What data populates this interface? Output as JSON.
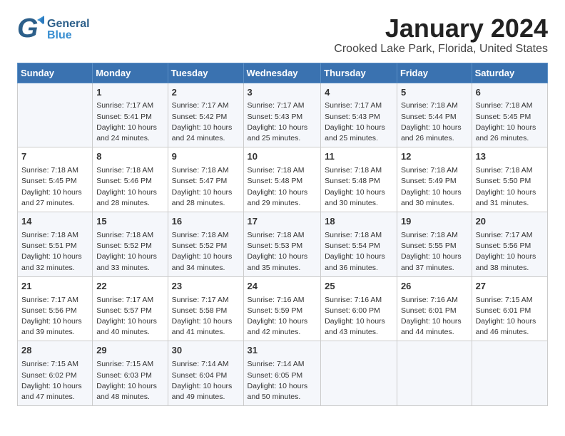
{
  "header": {
    "logo_general": "General",
    "logo_blue": "Blue",
    "title": "January 2024",
    "subtitle": "Crooked Lake Park, Florida, United States"
  },
  "days": [
    "Sunday",
    "Monday",
    "Tuesday",
    "Wednesday",
    "Thursday",
    "Friday",
    "Saturday"
  ],
  "weeks": [
    [
      {
        "date": "",
        "content": ""
      },
      {
        "date": "1",
        "content": "Sunrise: 7:17 AM\nSunset: 5:41 PM\nDaylight: 10 hours\nand 24 minutes."
      },
      {
        "date": "2",
        "content": "Sunrise: 7:17 AM\nSunset: 5:42 PM\nDaylight: 10 hours\nand 24 minutes."
      },
      {
        "date": "3",
        "content": "Sunrise: 7:17 AM\nSunset: 5:43 PM\nDaylight: 10 hours\nand 25 minutes."
      },
      {
        "date": "4",
        "content": "Sunrise: 7:17 AM\nSunset: 5:43 PM\nDaylight: 10 hours\nand 25 minutes."
      },
      {
        "date": "5",
        "content": "Sunrise: 7:18 AM\nSunset: 5:44 PM\nDaylight: 10 hours\nand 26 minutes."
      },
      {
        "date": "6",
        "content": "Sunrise: 7:18 AM\nSunset: 5:45 PM\nDaylight: 10 hours\nand 26 minutes."
      }
    ],
    [
      {
        "date": "7",
        "content": "Sunrise: 7:18 AM\nSunset: 5:45 PM\nDaylight: 10 hours\nand 27 minutes."
      },
      {
        "date": "8",
        "content": "Sunrise: 7:18 AM\nSunset: 5:46 PM\nDaylight: 10 hours\nand 28 minutes."
      },
      {
        "date": "9",
        "content": "Sunrise: 7:18 AM\nSunset: 5:47 PM\nDaylight: 10 hours\nand 28 minutes."
      },
      {
        "date": "10",
        "content": "Sunrise: 7:18 AM\nSunset: 5:48 PM\nDaylight: 10 hours\nand 29 minutes."
      },
      {
        "date": "11",
        "content": "Sunrise: 7:18 AM\nSunset: 5:48 PM\nDaylight: 10 hours\nand 30 minutes."
      },
      {
        "date": "12",
        "content": "Sunrise: 7:18 AM\nSunset: 5:49 PM\nDaylight: 10 hours\nand 30 minutes."
      },
      {
        "date": "13",
        "content": "Sunrise: 7:18 AM\nSunset: 5:50 PM\nDaylight: 10 hours\nand 31 minutes."
      }
    ],
    [
      {
        "date": "14",
        "content": "Sunrise: 7:18 AM\nSunset: 5:51 PM\nDaylight: 10 hours\nand 32 minutes."
      },
      {
        "date": "15",
        "content": "Sunrise: 7:18 AM\nSunset: 5:52 PM\nDaylight: 10 hours\nand 33 minutes."
      },
      {
        "date": "16",
        "content": "Sunrise: 7:18 AM\nSunset: 5:52 PM\nDaylight: 10 hours\nand 34 minutes."
      },
      {
        "date": "17",
        "content": "Sunrise: 7:18 AM\nSunset: 5:53 PM\nDaylight: 10 hours\nand 35 minutes."
      },
      {
        "date": "18",
        "content": "Sunrise: 7:18 AM\nSunset: 5:54 PM\nDaylight: 10 hours\nand 36 minutes."
      },
      {
        "date": "19",
        "content": "Sunrise: 7:18 AM\nSunset: 5:55 PM\nDaylight: 10 hours\nand 37 minutes."
      },
      {
        "date": "20",
        "content": "Sunrise: 7:17 AM\nSunset: 5:56 PM\nDaylight: 10 hours\nand 38 minutes."
      }
    ],
    [
      {
        "date": "21",
        "content": "Sunrise: 7:17 AM\nSunset: 5:56 PM\nDaylight: 10 hours\nand 39 minutes."
      },
      {
        "date": "22",
        "content": "Sunrise: 7:17 AM\nSunset: 5:57 PM\nDaylight: 10 hours\nand 40 minutes."
      },
      {
        "date": "23",
        "content": "Sunrise: 7:17 AM\nSunset: 5:58 PM\nDaylight: 10 hours\nand 41 minutes."
      },
      {
        "date": "24",
        "content": "Sunrise: 7:16 AM\nSunset: 5:59 PM\nDaylight: 10 hours\nand 42 minutes."
      },
      {
        "date": "25",
        "content": "Sunrise: 7:16 AM\nSunset: 6:00 PM\nDaylight: 10 hours\nand 43 minutes."
      },
      {
        "date": "26",
        "content": "Sunrise: 7:16 AM\nSunset: 6:01 PM\nDaylight: 10 hours\nand 44 minutes."
      },
      {
        "date": "27",
        "content": "Sunrise: 7:15 AM\nSunset: 6:01 PM\nDaylight: 10 hours\nand 46 minutes."
      }
    ],
    [
      {
        "date": "28",
        "content": "Sunrise: 7:15 AM\nSunset: 6:02 PM\nDaylight: 10 hours\nand 47 minutes."
      },
      {
        "date": "29",
        "content": "Sunrise: 7:15 AM\nSunset: 6:03 PM\nDaylight: 10 hours\nand 48 minutes."
      },
      {
        "date": "30",
        "content": "Sunrise: 7:14 AM\nSunset: 6:04 PM\nDaylight: 10 hours\nand 49 minutes."
      },
      {
        "date": "31",
        "content": "Sunrise: 7:14 AM\nSunset: 6:05 PM\nDaylight: 10 hours\nand 50 minutes."
      },
      {
        "date": "",
        "content": ""
      },
      {
        "date": "",
        "content": ""
      },
      {
        "date": "",
        "content": ""
      }
    ]
  ]
}
